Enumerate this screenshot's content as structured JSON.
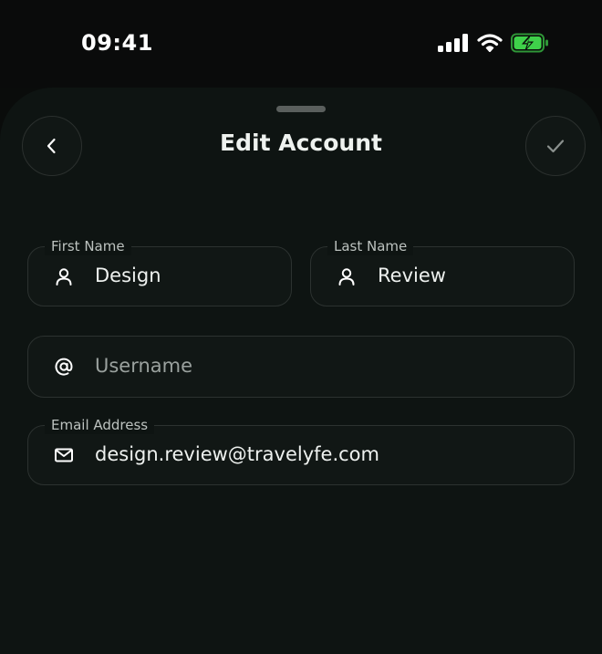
{
  "status_bar": {
    "time": "09:41",
    "icons": [
      "signal-icon",
      "wifi-icon",
      "battery-charging-icon"
    ],
    "battery_color": "#3fd14a"
  },
  "header": {
    "title": "Edit Account",
    "back_icon": "chevron-left-icon",
    "confirm_icon": "checkmark-icon"
  },
  "form": {
    "first_name": {
      "label": "First Name",
      "value": "Design",
      "icon": "user-icon"
    },
    "last_name": {
      "label": "Last Name",
      "value": "Review",
      "icon": "user-icon"
    },
    "username": {
      "placeholder": "Username",
      "icon": "at-icon"
    },
    "email": {
      "label": "Email Address",
      "value": "design.review@travelyfe.com",
      "icon": "mail-icon"
    }
  },
  "colors": {
    "background": "#0a0c0b",
    "sheet": "#0e1412",
    "field_border": "#2c3230",
    "text": "#eef1ef",
    "muted": "#9aa19e"
  }
}
